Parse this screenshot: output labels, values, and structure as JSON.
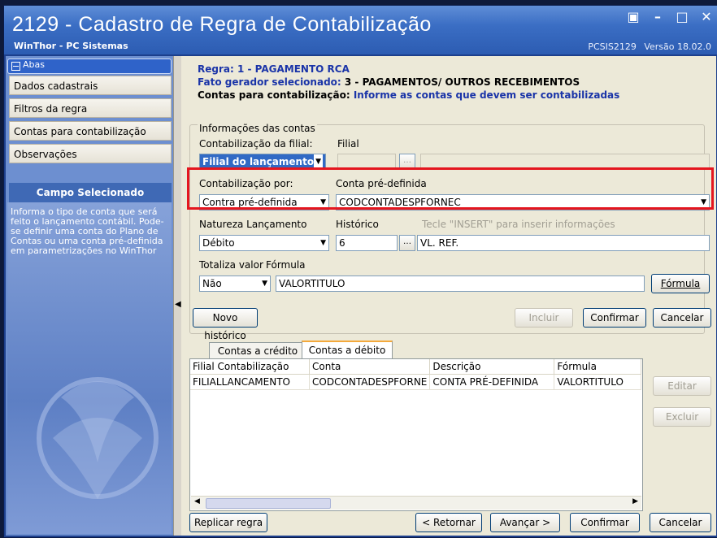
{
  "window": {
    "title": "2129 - Cadastro de Regra de Contabilização",
    "company": "WinThor - PC Sistemas",
    "program": "PCSIS2129",
    "version": "Versão 18.02.0"
  },
  "sidebar": {
    "header": "Abas",
    "items": [
      {
        "label": "Dados cadastrais"
      },
      {
        "label": "Filtros da regra"
      },
      {
        "label": "Contas para contabilização"
      },
      {
        "label": "Observações"
      }
    ],
    "campo_title": "Campo Selecionado",
    "campo_desc": "Informa o tipo de conta que será feito o lançamento contábil. Pode-se definir uma conta do Plano de Contas ou uma conta pré-definida em parametrizações no WinThor"
  },
  "header": {
    "regra_label": "Regra:",
    "regra_value": "1 - PAGAMENTO RCA",
    "fato_label": "Fato gerador selecionado:",
    "fato_value": "3 - PAGAMENTOS/ OUTROS RECEBIMENTOS",
    "contas_label": "Contas para contabilização:",
    "contas_value": "Informe as contas que devem ser contabilizadas"
  },
  "form": {
    "group_title": "Informações das contas",
    "contab_filial_label": "Contabilização da filial:",
    "contab_filial_value": "Filial do lançamento",
    "filial_label": "Filial",
    "contab_por_label": "Contabilização por:",
    "contab_por_value": "Contra pré-definida",
    "conta_pre_label": "Conta pré-definida",
    "conta_pre_value": "CODCONTADESPFORNEC",
    "natureza_label": "Natureza Lançamento",
    "natureza_value": "Débito",
    "historico_label": "Histórico",
    "historico_hint": "Tecle \"INSERT\" para inserir informações",
    "historico_code": "6",
    "historico_desc": "VL. REF.",
    "totaliza_label": "Totaliza valor",
    "totaliza_value": "Não",
    "formula_label": "Fórmula",
    "formula_value": "VALORTITULO",
    "formula_button": "Fórmula",
    "novo_historico_button": "Novo histórico",
    "incluir_button": "Incluir",
    "confirmar_button": "Confirmar",
    "cancelar_button": "Cancelar"
  },
  "tabs": [
    {
      "label": "Contas a crédito"
    },
    {
      "label": "Contas a débito"
    }
  ],
  "grid": {
    "columns": [
      "Filial Contabilização",
      "Conta",
      "Descrição",
      "Fórmula"
    ],
    "rows": [
      [
        "FILIALLANCAMENTO",
        "CODCONTADESPFORNE",
        "CONTA PRÉ-DEFINIDA",
        "VALORTITULO"
      ]
    ],
    "editar_button": "Editar",
    "excluir_button": "Excluir"
  },
  "footer": {
    "replicar_button": "Replicar regra",
    "retornar_button": "< Retornar",
    "avancar_button": "Avançar >",
    "confirmar_button": "Confirmar",
    "cancelar_button": "Cancelar"
  },
  "colors": {
    "title_blue": "#2c5cb2",
    "highlight_red": "#e4161f",
    "selection_blue": "#316ac5",
    "label_blue": "#1a34a8"
  }
}
